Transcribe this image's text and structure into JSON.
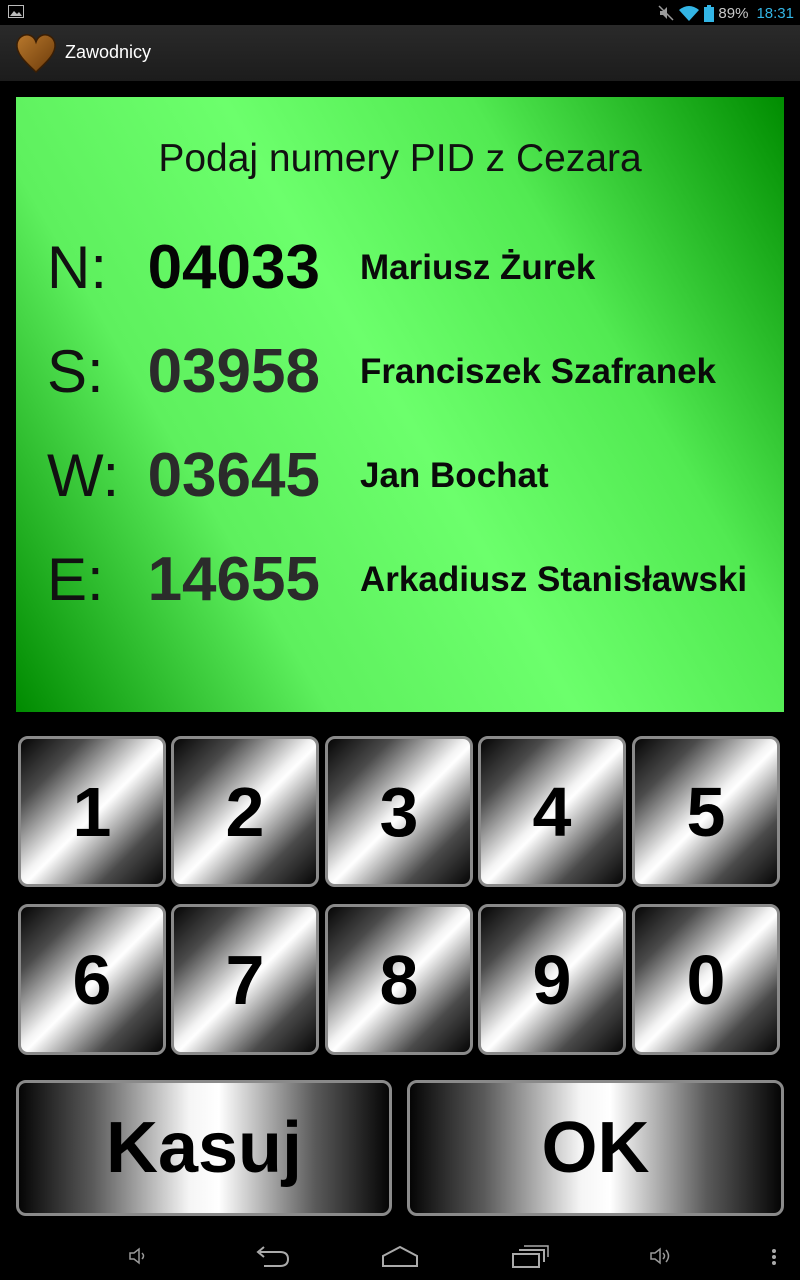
{
  "status": {
    "battery_pct": "89%",
    "time": "18:31"
  },
  "action_bar": {
    "title": "Zawodnicy"
  },
  "panel": {
    "heading": "Podaj numery PID z Cezara",
    "rows": [
      {
        "letter": "N:",
        "number": "04033",
        "name": "Mariusz Żurek"
      },
      {
        "letter": "S:",
        "number": "03958",
        "name": "Franciszek Szafranek"
      },
      {
        "letter": "W:",
        "number": "03645",
        "name": "Jan Bochat"
      },
      {
        "letter": "E:",
        "number": "14655",
        "name": "Arkadiusz Stanisławski"
      }
    ]
  },
  "keypad": {
    "digits": [
      "1",
      "2",
      "3",
      "4",
      "5",
      "6",
      "7",
      "8",
      "9",
      "0"
    ],
    "clear_label": "Kasuj",
    "ok_label": "OK"
  },
  "colors": {
    "panel_green": "#6cff6c",
    "clock_blue": "#33b5e5"
  }
}
